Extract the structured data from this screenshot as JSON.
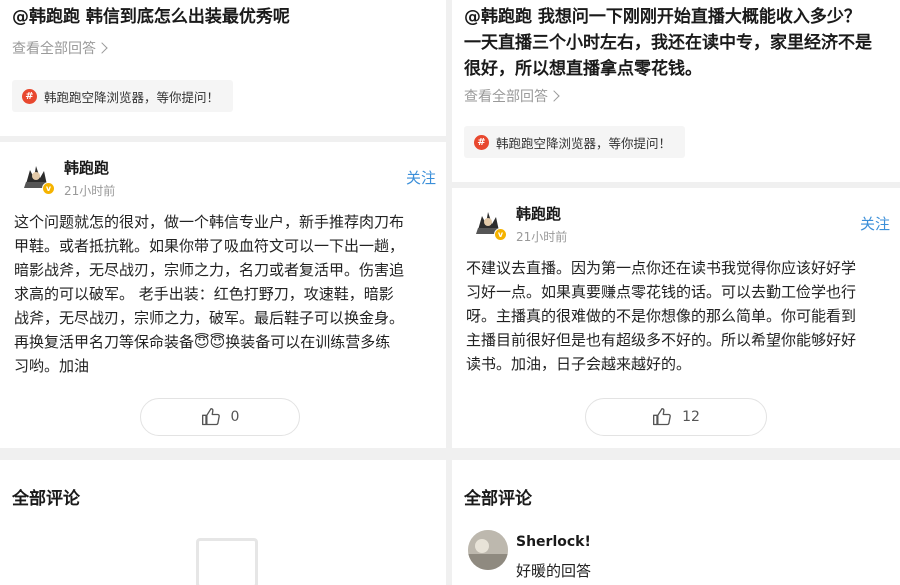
{
  "left": {
    "question": "@韩跑跑  韩信到底怎么出装最优秀呢",
    "view_all": "查看全部回答",
    "invite": "韩跑跑空降浏览器，等你提问！",
    "author": {
      "name": "韩跑跑",
      "time": "21小时前",
      "follow": "关注"
    },
    "answer_lines": [
      "这个问题就怎的很对，做一个韩信专业户，新手推荐肉刀布",
      "甲鞋。或者抵抗靴。如果你带了吸血符文可以一下出一趟，",
      "暗影战斧，无尽战刃，宗师之力，名刀或者复活甲。伤害追",
      "求高的可以破军。  老手出装：红色打野刀，攻速鞋，暗影",
      "战斧，无尽战刃，宗师之力，破军。最后鞋子可以换金身。",
      "再换复活甲名刀等保命装备😇😇换装备可以在训练营多练",
      "习哟。加油"
    ],
    "likes": "0",
    "comments_title": "全部评论"
  },
  "right": {
    "question": "@韩跑跑  我想问一下刚刚开始直播大概能收入多少？一天直播三个小时左右，我还在读中专，家里经济不是很好，所以想直播拿点零花钱。",
    "view_all": "查看全部回答",
    "invite": "韩跑跑空降浏览器，等你提问！",
    "author": {
      "name": "韩跑跑",
      "time": "21小时前",
      "follow": "关注"
    },
    "answer_lines": [
      "不建议去直播。因为第一点你还在读书我觉得你应该好好学",
      "习好一点。如果真要赚点零花钱的话。可以去勤工俭学也行",
      "呀。主播真的很难做的不是你想像的那么简单。你可能看到",
      "主播目前很好但是也有超级多不好的。所以希望你能够好好",
      "读书。加油，日子会越来越好的。"
    ],
    "likes": "12",
    "comments_title": "全部评论",
    "comment": {
      "name": "Sherlock!",
      "text": "好暖的回答"
    }
  },
  "icons": {
    "invite": "invite-badge-icon",
    "like": "thumbs-up-icon",
    "verified": "verified-v-icon"
  },
  "colors": {
    "accent": "#3b8fd9",
    "badge": "#e8482f",
    "verified": "#f5b300"
  }
}
